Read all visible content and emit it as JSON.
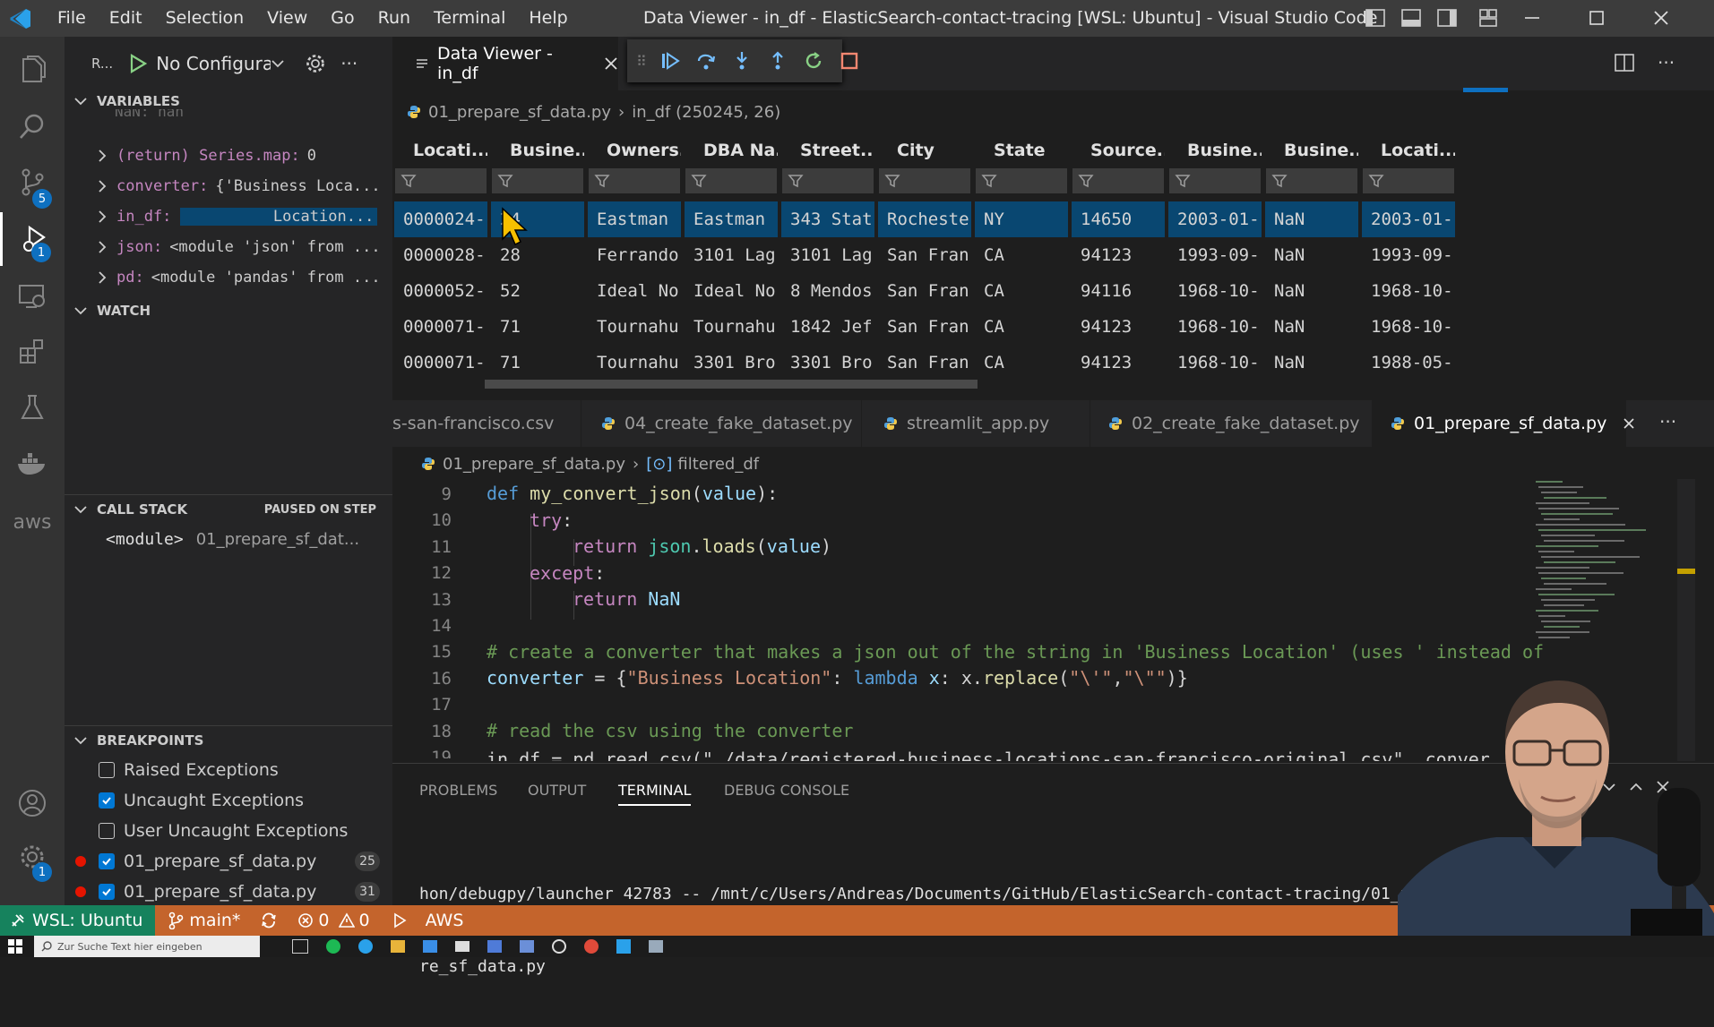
{
  "window": {
    "title": "Data Viewer - in_df - ElasticSearch-contact-tracing [WSL: Ubuntu] - Visual Studio Code",
    "menu": [
      "File",
      "Edit",
      "Selection",
      "View",
      "Go",
      "Run",
      "Terminal",
      "Help"
    ]
  },
  "activity_bar": {
    "badges": {
      "source_control": "5",
      "debug": "1",
      "accounts_settings": "1"
    },
    "aws_label": "aws"
  },
  "sidebar": {
    "run_label": "R...",
    "config_select": "No Configurati",
    "variables": {
      "header": "VARIABLES",
      "clipped_row": "NaN: nan",
      "items": [
        {
          "key": "(return) Series.map:",
          "value": "0"
        },
        {
          "key": "converter:",
          "value": "{'Business Loca..."
        },
        {
          "key": "in_df:",
          "value": "Location..."
        },
        {
          "key": "json:",
          "value": "<module 'json' from ..."
        },
        {
          "key": "pd:",
          "value": "<module 'pandas' from ..."
        }
      ]
    },
    "watch": {
      "header": "WATCH"
    },
    "call_stack": {
      "header": "CALL STACK",
      "status": "PAUSED ON STEP",
      "frame": {
        "name": "<module>",
        "file": "01_prepare_sf_dat..."
      }
    },
    "breakpoints": {
      "header": "BREAKPOINTS",
      "items": [
        {
          "label": "Raised Exceptions",
          "checked": false
        },
        {
          "label": "Uncaught Exceptions",
          "checked": true
        },
        {
          "label": "User Uncaught Exceptions",
          "checked": false
        },
        {
          "label": "01_prepare_sf_data.py",
          "checked": true,
          "line": "25"
        },
        {
          "label": "01_prepare_sf_data.py",
          "checked": true,
          "line": "31"
        }
      ]
    }
  },
  "editor_top": {
    "tab_label": "Data Viewer - in_df",
    "breadcrumb": {
      "file": "01_prepare_sf_data.py",
      "item": "in_df (250245, 26)"
    }
  },
  "data_viewer": {
    "columns": [
      "Locati...",
      "Busine...",
      "Owners...",
      "DBA Na...",
      "Street...",
      "City",
      "State",
      "Source...",
      "Busine...",
      "Busine...",
      "Locati..."
    ],
    "rows": [
      [
        "0000024-...",
        "24",
        "Eastman ...",
        "Eastman ...",
        "343 Stat...",
        "Rochester",
        "NY",
        "14650",
        "2003-01-...",
        "NaN",
        "2003-01-"
      ],
      [
        "0000028-...",
        "28",
        "Ferrando...",
        "3101 Lag...",
        "3101 Lag...",
        "San Fran...",
        "CA",
        "94123",
        "1993-09-...",
        "NaN",
        "1993-09-"
      ],
      [
        "0000052-...",
        "52",
        "Ideal No...",
        "Ideal No...",
        "8 Mendos...",
        "San Fran...",
        "CA",
        "94116",
        "1968-10-...",
        "NaN",
        "1968-10-"
      ],
      [
        "0000071-...",
        "71",
        "Tournahu...",
        "Tournahu...",
        "1842 Jef...",
        "San Fran...",
        "CA",
        "94123",
        "1968-10-...",
        "NaN",
        "1968-10-"
      ],
      [
        "0000071-...",
        "71",
        "Tournahu...",
        "3301 Bro...",
        "3301 Bro...",
        "San Fran...",
        "CA",
        "94123",
        "1968-10-...",
        "NaN",
        "1988-05-"
      ]
    ]
  },
  "editor_tabs": [
    {
      "label": "s-san-francisco.csv",
      "active": false
    },
    {
      "label": "04_create_fake_dataset.py",
      "active": false
    },
    {
      "label": "streamlit_app.py",
      "active": false
    },
    {
      "label": "02_create_fake_dataset.py",
      "active": false
    },
    {
      "label": "01_prepare_sf_data.py",
      "active": true
    }
  ],
  "code_breadcrumb": {
    "file": "01_prepare_sf_data.py",
    "symbol": "filtered_df"
  },
  "code": {
    "line_numbers": [
      "9",
      "10",
      "11",
      "12",
      "13",
      "14",
      "15",
      "16",
      "17",
      "18",
      "19"
    ],
    "l9": {
      "kw": "def",
      "fn": "my_convert_json",
      "p1": "(",
      "param": "value",
      "p2": "):"
    },
    "l10": {
      "kw": "try",
      "p": ":"
    },
    "l11": {
      "kw": "return",
      "mod": "json",
      "dot": ".",
      "fn": "loads",
      "p1": "(",
      "param": "value",
      "p2": ")"
    },
    "l12": {
      "kw": "except",
      "p": ":"
    },
    "l13": {
      "kw": "return",
      "val": "NaN"
    },
    "l15": "# create a converter that makes a json out of the string in 'Business Location' (uses ' instead of",
    "l16": {
      "var": "converter",
      "eq": " = {",
      "s1": "\"Business Location\"",
      "colon": ": ",
      "kw": "lambda",
      "x": " x",
      "rest1": ": x.",
      "fn": "replace",
      "p1": "(",
      "s2": "\"\\'\"",
      "comma": ",",
      "s3": "\"\\\"\"",
      "p2": ")}"
    },
    "l18": "# read the csv using the converter",
    "l19": "in_df = pd.read_csv(\"./data/registered-business-locations-san-francisco-original.csv\", conver"
  },
  "panel": {
    "tabs": [
      "PROBLEMS",
      "OUTPUT",
      "TERMINAL",
      "DEBUG CONSOLE"
    ],
    "active_tab": "TERMINAL",
    "terminal_lines": [
      "hon/debugpy/launcher 42783 -- /mnt/c/Users/Andreas/Documents/GitHub/ElasticSearch-contact-tracing/01_p",
      "re_sf_data.py"
    ]
  },
  "statusbar": {
    "remote": "WSL: Ubuntu",
    "branch": "main*",
    "errors": "0",
    "warnings": "0",
    "aws": "AWS"
  },
  "taskbar": {
    "search_placeholder": "Zur Suche Text hier eingeben"
  },
  "colors": {
    "accent": "#0078d4",
    "statusbar": "#c4642c",
    "selected_row": "#094771",
    "breakpoint": "#e51400"
  }
}
